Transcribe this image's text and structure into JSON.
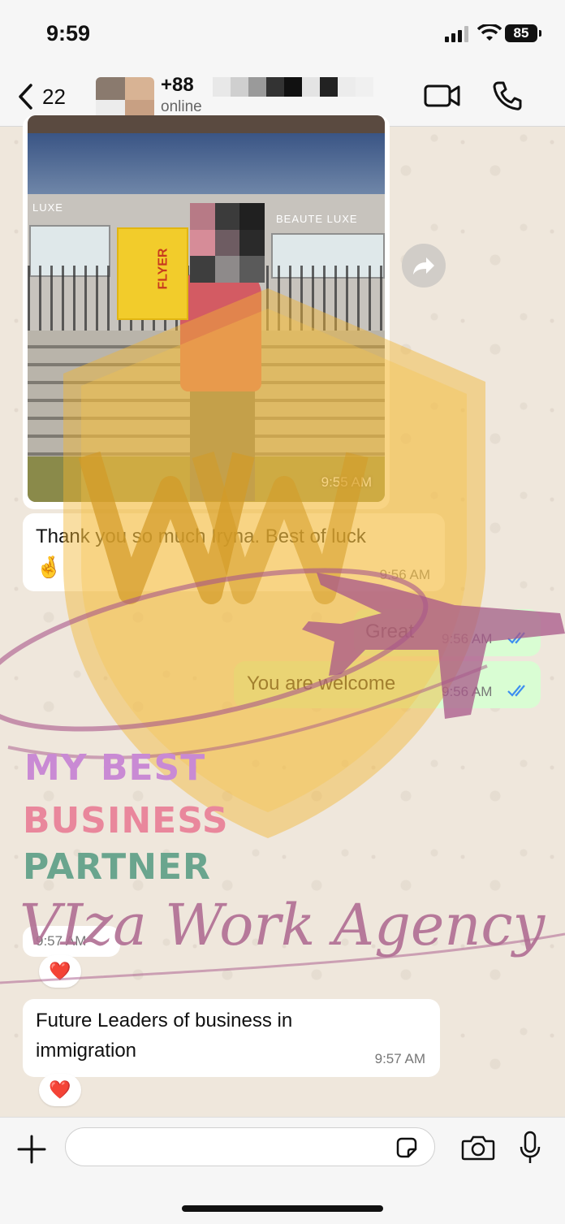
{
  "status_bar": {
    "time": "9:59",
    "battery": "85"
  },
  "header": {
    "back_count": "22",
    "contact_name": "+88",
    "contact_status": "online"
  },
  "messages": [
    {
      "type": "image",
      "direction": "in",
      "time": "9:55 AM",
      "photo_sign_left": "LUXE",
      "photo_sign_right": "BEAUTE LUXE",
      "photo_flyer_text": "FLYER"
    },
    {
      "type": "text",
      "direction": "in",
      "text": "Thank you so much Iryna. Best of luck",
      "emoji": "🤞",
      "time": "9:56 AM"
    },
    {
      "type": "text",
      "direction": "out",
      "text": "Great",
      "time": "9:56 AM",
      "status": "read"
    },
    {
      "type": "text",
      "direction": "out",
      "text": "You are welcome",
      "time": "9:56 AM",
      "status": "read"
    },
    {
      "type": "media",
      "direction": "in",
      "time": "9:57 AM",
      "reaction": "❤️"
    },
    {
      "type": "text",
      "direction": "in",
      "text_line1": "Future Leaders of business in",
      "text_line2": "immigration",
      "time": "9:57 AM",
      "reaction": "❤️"
    }
  ],
  "watermark": {
    "line1": "MY BEST",
    "line2": "BUSINESS",
    "line3": "PARTNER",
    "agency": "VIza Work Agency",
    "colors": {
      "shield": "#f2b632",
      "plane": "#a8578a"
    }
  },
  "input_bar": {
    "placeholder": ""
  },
  "icons": {
    "back": "chevron-left-icon",
    "video": "video-camera-icon",
    "phone": "phone-icon",
    "forward": "forward-arrow-icon",
    "plus": "plus-icon",
    "sticker": "sticker-icon",
    "camera": "camera-icon",
    "mic": "microphone-icon"
  },
  "colors": {
    "outgoing_bubble": "#d9fdd3",
    "incoming_bubble": "#ffffff",
    "read_ticks": "#3d8ef0",
    "wallpaper": "#efe7dc"
  }
}
